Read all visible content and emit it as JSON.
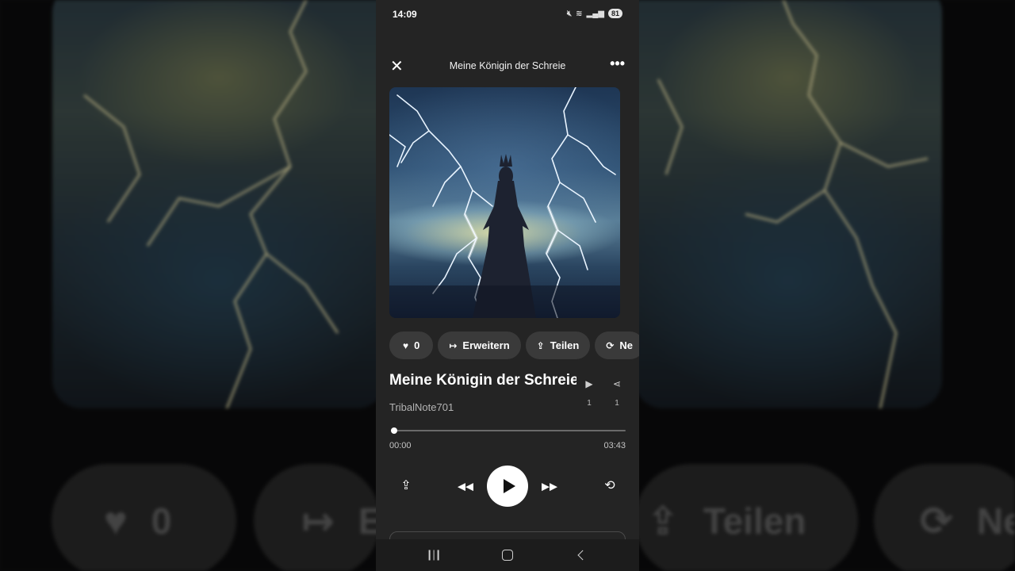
{
  "status_bar": {
    "time": "14:09",
    "battery": "81"
  },
  "player": {
    "header_title": "Meine Königin der Schreie",
    "song_title": "Meine Königin der Schreie",
    "artist": "TribalNote701",
    "actions": [
      {
        "icon": "heart-icon",
        "label": "0"
      },
      {
        "icon": "extend-icon",
        "label": "Erweitern"
      },
      {
        "icon": "share-icon",
        "label": "Teilen"
      },
      {
        "icon": "remix-icon",
        "label": "Ne"
      }
    ],
    "stats": {
      "plays": "1",
      "shares": "1"
    },
    "progress": {
      "current": "00:00",
      "total": "03:43",
      "fraction": 0.01
    }
  },
  "background_actions": {
    "like": "0",
    "extend": "Er",
    "share": "Teilen",
    "remix": "Ne"
  },
  "colors": {
    "panel": "#242424",
    "pill": "#3a3a3a",
    "accent": "#ffffff"
  }
}
